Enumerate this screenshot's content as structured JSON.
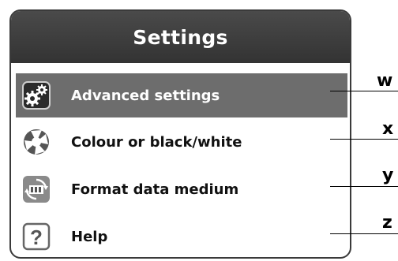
{
  "title": "Settings",
  "menu": {
    "items": [
      {
        "label": "Advanced settings",
        "icon": "gears-icon",
        "selected": true
      },
      {
        "label": "Colour or black/white",
        "icon": "aperture-icon",
        "selected": false
      },
      {
        "label": "Format data medium",
        "icon": "format-card-icon",
        "selected": false
      },
      {
        "label": "Help",
        "icon": "help-icon",
        "selected": false
      }
    ]
  },
  "callouts": [
    "w",
    "x",
    "y",
    "z"
  ],
  "colors": {
    "title_bar": "#3c3c3c",
    "selected_row": "#6d6d6d",
    "border": "#3a3a3a"
  }
}
